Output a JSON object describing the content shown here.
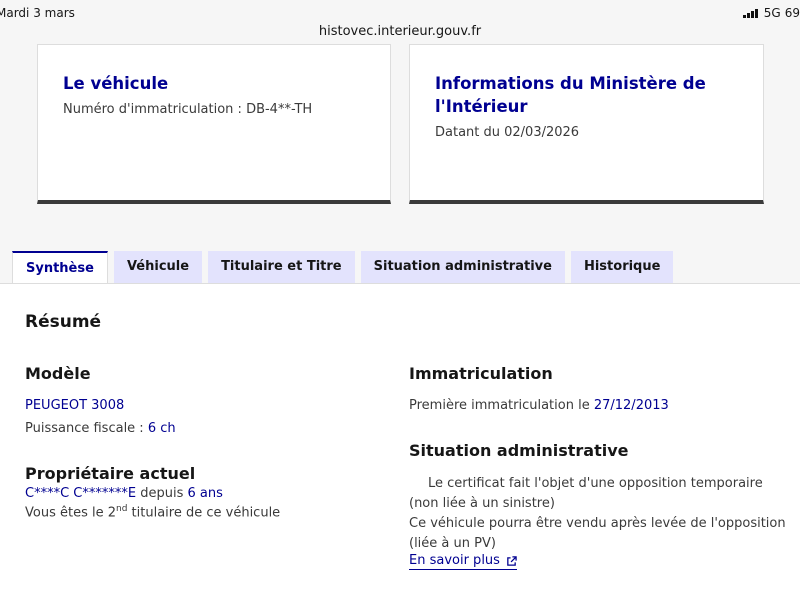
{
  "status_bar": {
    "time": "Mardi 3 mars",
    "network": "5G",
    "battery": "69"
  },
  "browser": {
    "url": "histovec.interieur.gouv.fr"
  },
  "cards": {
    "vehicle": {
      "title": "Le véhicule",
      "subtitle": "Numéro d'immatriculation : DB-4**-TH"
    },
    "ministry": {
      "title": "Informations du Ministère de l'Intérieur",
      "subtitle": "Datant du 02/03/2026"
    }
  },
  "tabs": [
    {
      "label": "Synthèse",
      "active": true
    },
    {
      "label": "Véhicule",
      "active": false
    },
    {
      "label": "Titulaire et Titre",
      "active": false
    },
    {
      "label": "Situation administrative",
      "active": false
    },
    {
      "label": "Historique",
      "active": false
    }
  ],
  "summary": {
    "title": "Résumé",
    "model": {
      "heading": "Modèle",
      "name": "PEUGEOT 3008",
      "fiscal_label": "Puissance fiscale : ",
      "fiscal_value": "6 ch"
    },
    "owner": {
      "heading": "Propriétaire actuel",
      "name": "C****C C*******E",
      "since_label": " depuis ",
      "since_value": "6 ans",
      "rank_prefix": "Vous êtes le 2",
      "rank_sup": "nd",
      "rank_suffix": " titulaire de ce véhicule"
    },
    "registration": {
      "heading": "Immatriculation",
      "first_label": "Première immatriculation le ",
      "first_date": "27/12/2013"
    },
    "admin": {
      "heading": "Situation administrative",
      "line1": "Le certificat fait l'objet d'une opposition temporaire",
      "line2": "(non liée à un sinistre)",
      "line3": "Ce véhicule pourra être vendu après levée de l'opposition",
      "line4": "(liée à un PV)",
      "link": "En savoir plus"
    }
  }
}
